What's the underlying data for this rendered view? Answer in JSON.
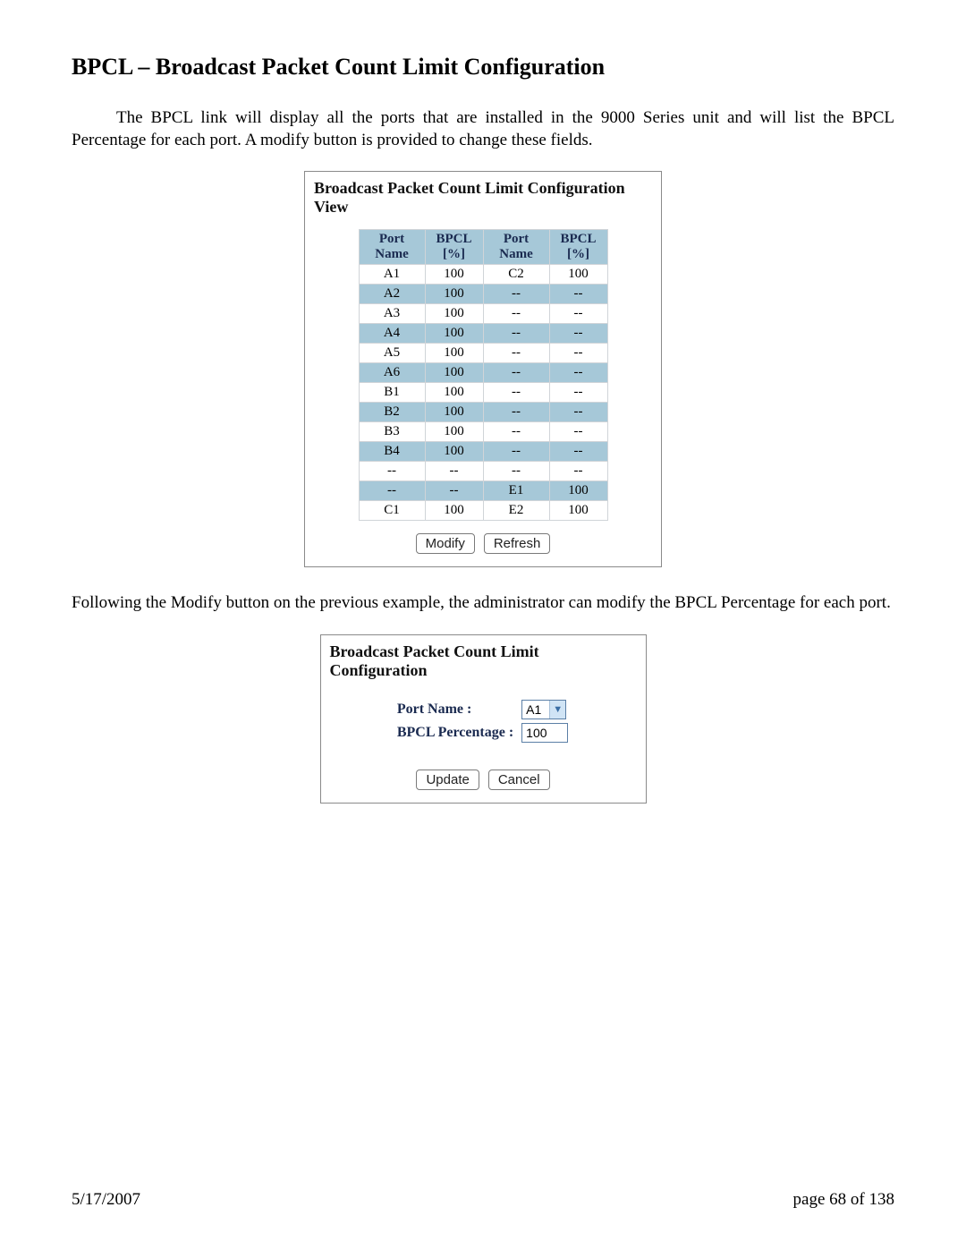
{
  "heading": "BPCL – Broadcast Packet Count Limit Configuration",
  "intro": "The BPCL link will display all the ports that are installed in the 9000 Series unit and will list the BPCL Percentage for each port.  A modify button is provided to change these fields.",
  "view_panel": {
    "title": "Broadcast Packet Count Limit Configuration View",
    "headers": [
      "Port Name",
      "BPCL [%]",
      "Port Name",
      "BPCL [%]"
    ],
    "rows": [
      {
        "c": [
          "A1",
          "100",
          "C2",
          "100"
        ],
        "alt": false
      },
      {
        "c": [
          "A2",
          "100",
          "--",
          "--"
        ],
        "alt": true
      },
      {
        "c": [
          "A3",
          "100",
          "--",
          "--"
        ],
        "alt": false
      },
      {
        "c": [
          "A4",
          "100",
          "--",
          "--"
        ],
        "alt": true
      },
      {
        "c": [
          "A5",
          "100",
          "--",
          "--"
        ],
        "alt": false
      },
      {
        "c": [
          "A6",
          "100",
          "--",
          "--"
        ],
        "alt": true
      },
      {
        "c": [
          "B1",
          "100",
          "--",
          "--"
        ],
        "alt": false
      },
      {
        "c": [
          "B2",
          "100",
          "--",
          "--"
        ],
        "alt": true
      },
      {
        "c": [
          "B3",
          "100",
          "--",
          "--"
        ],
        "alt": false
      },
      {
        "c": [
          "B4",
          "100",
          "--",
          "--"
        ],
        "alt": true
      },
      {
        "c": [
          "--",
          "--",
          "--",
          "--"
        ],
        "alt": false
      },
      {
        "c": [
          "--",
          "--",
          "E1",
          "100"
        ],
        "alt": true
      },
      {
        "c": [
          "C1",
          "100",
          "E2",
          "100"
        ],
        "alt": false
      }
    ],
    "buttons": {
      "modify": "Modify",
      "refresh": "Refresh"
    }
  },
  "mid_text": "Following the Modify button on the previous example, the administrator can modify the BPCL Percentage for each port.",
  "edit_panel": {
    "title": "Broadcast Packet Count Limit Configuration",
    "port_label": "Port Name :",
    "port_value": "A1",
    "bpcl_label": "BPCL Percentage :",
    "bpcl_value": "100",
    "buttons": {
      "update": "Update",
      "cancel": "Cancel"
    }
  },
  "footer": {
    "date": "5/17/2007",
    "page": "page 68 of 138"
  },
  "chart_data": {
    "type": "table",
    "title": "Broadcast Packet Count Limit Configuration View",
    "columns": [
      "Port Name",
      "BPCL [%]",
      "Port Name",
      "BPCL [%]"
    ],
    "rows": [
      [
        "A1",
        100,
        "C2",
        100
      ],
      [
        "A2",
        100,
        null,
        null
      ],
      [
        "A3",
        100,
        null,
        null
      ],
      [
        "A4",
        100,
        null,
        null
      ],
      [
        "A5",
        100,
        null,
        null
      ],
      [
        "A6",
        100,
        null,
        null
      ],
      [
        "B1",
        100,
        null,
        null
      ],
      [
        "B2",
        100,
        null,
        null
      ],
      [
        "B3",
        100,
        null,
        null
      ],
      [
        "B4",
        100,
        null,
        null
      ],
      [
        null,
        null,
        null,
        null
      ],
      [
        null,
        null,
        "E1",
        100
      ],
      [
        "C1",
        100,
        "E2",
        100
      ]
    ]
  }
}
